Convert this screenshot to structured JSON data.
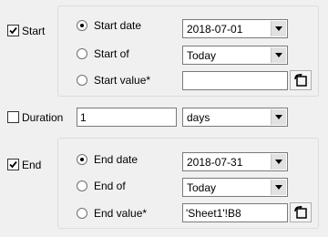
{
  "start": {
    "checkbox_label": "Start",
    "checked": true,
    "options": {
      "date_label": "Start date",
      "of_label": "Start of",
      "value_label": "Start value*"
    },
    "selected_option": "date",
    "date_value": "2018-07-01",
    "of_value": "Today",
    "value_field": ""
  },
  "duration": {
    "checkbox_label": "Duration",
    "checked": false,
    "amount": "1",
    "unit": "days"
  },
  "end": {
    "checkbox_label": "End",
    "checked": true,
    "options": {
      "date_label": "End date",
      "of_label": "End of",
      "value_label": "End value*"
    },
    "selected_option": "date",
    "date_value": "2018-07-31",
    "of_value": "Today",
    "value_field": "'Sheet1'!B8"
  },
  "icons": {
    "dropdown": "chevron-down-icon",
    "range_picker": "range-picker-icon"
  }
}
